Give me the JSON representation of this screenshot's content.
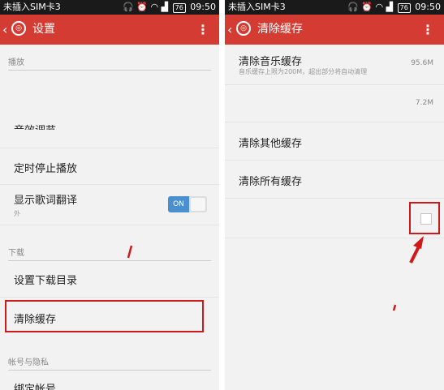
{
  "status_bar": {
    "carrier": "未插入SIM卡3",
    "battery": "76",
    "time": "09:50"
  },
  "left_screen": {
    "title": "设置",
    "menu_icon": "⋮",
    "sections": {
      "playback": "播放",
      "download": "下载",
      "account": "帐号与隐私"
    },
    "items": {
      "sound_effect": "音效调节",
      "sleep_timer": "定时停止播放",
      "lyrics_translation": "显示歌词翻译",
      "lyrics_translation_sub": "外",
      "download_dir": "设置下载目录",
      "clear_cache": "清除缓存",
      "bind_account": "绑定帐号"
    },
    "toggle_label": "ON"
  },
  "right_screen": {
    "title": "清除缓存",
    "menu_icon": "⋮",
    "items": {
      "clear_music_cache": "清除音乐缓存",
      "clear_music_cache_sub": "音乐缓存上限为200M，超出部分将自动清理",
      "music_cache_size": "95.6M",
      "second_size": "7.2M",
      "clear_other_cache": "清除其他缓存",
      "clear_all_cache": "清除所有缓存"
    }
  },
  "colors": {
    "accent": "#d43c33",
    "status_bar": "#1a1a1a",
    "highlight": "#cc1a1a",
    "toggle_on": "#4a8fd0"
  },
  "icons": {
    "back": "chevron-left-icon",
    "logo": "netease-music-logo-icon",
    "menu": "overflow-menu-icon",
    "status": [
      "headphones-icon",
      "alarm-icon",
      "wifi-icon",
      "signal-icon",
      "battery-icon"
    ]
  }
}
